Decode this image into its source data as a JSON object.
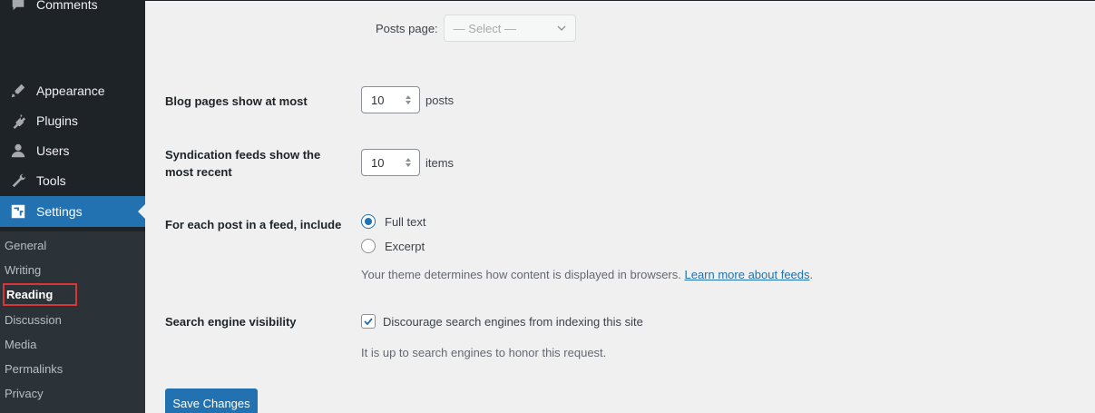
{
  "sidebar": {
    "items": [
      {
        "label": "Comments",
        "icon": "comments-icon"
      },
      {
        "label": "Appearance",
        "icon": "appearance-icon"
      },
      {
        "label": "Plugins",
        "icon": "plugins-icon"
      },
      {
        "label": "Users",
        "icon": "users-icon"
      },
      {
        "label": "Tools",
        "icon": "tools-icon"
      },
      {
        "label": "Settings",
        "icon": "settings-icon"
      }
    ],
    "submenu": [
      "General",
      "Writing",
      "Reading",
      "Discussion",
      "Media",
      "Permalinks",
      "Privacy"
    ],
    "active_submenu": "Reading",
    "highlight_color": "#d63638"
  },
  "main": {
    "posts_page": {
      "label": "Posts page:",
      "value": "— Select —"
    },
    "blog_pages": {
      "label": "Blog pages show at most",
      "value": "10",
      "suffix": "posts"
    },
    "syndication": {
      "label": "Syndication feeds show the most recent",
      "value": "10",
      "suffix": "items"
    },
    "feed": {
      "label": "For each post in a feed, include",
      "options": [
        {
          "label": "Full text",
          "checked": true
        },
        {
          "label": "Excerpt",
          "checked": false
        }
      ],
      "desc": "Your theme determines how content is displayed in browsers. ",
      "link": "Learn more about feeds",
      "desc_end": "."
    },
    "search": {
      "label": "Search engine visibility",
      "checkbox_label": "Discourage search engines from indexing this site",
      "checked": true,
      "desc": "It is up to search engines to honor this request."
    },
    "save_label": "Save Changes"
  },
  "colors": {
    "accent": "#2271b1",
    "sidebar_bg": "#1d2327",
    "submenu_bg": "#2c3338",
    "page_bg": "#f0f0f1"
  }
}
